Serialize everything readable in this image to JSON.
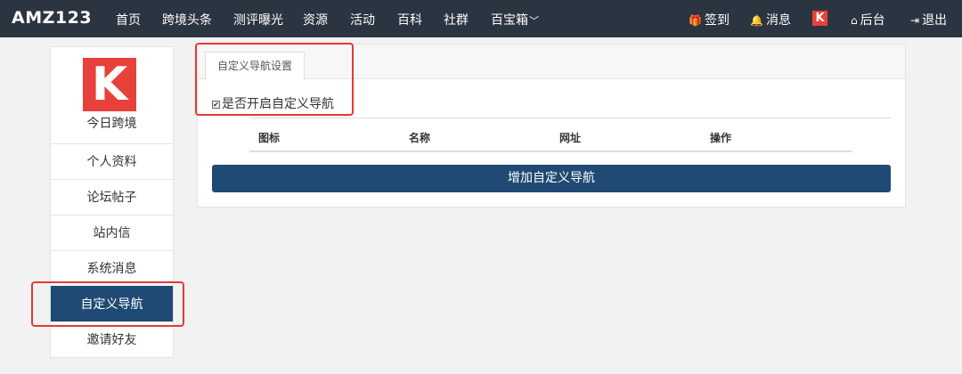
{
  "brand": "AMZ123",
  "nav": {
    "items": [
      "首页",
      "跨境头条",
      "测评曝光",
      "资源",
      "活动",
      "百科",
      "社群",
      "百宝箱"
    ],
    "right": {
      "checkin": "签到",
      "messages": "消息",
      "k_badge": "K",
      "backend": "后台",
      "logout": "退出"
    }
  },
  "sidebar": {
    "logo_letter": "K",
    "site_name": "今日跨境",
    "items": [
      "个人资料",
      "论坛帖子",
      "站内信",
      "系统消息",
      "自定义导航",
      "邀请好友"
    ],
    "active_index": 4
  },
  "panel": {
    "tab_label": "自定义导航设置",
    "checkbox_label": "是否开启自定义导航",
    "checkbox_checked": true,
    "columns": [
      "图标",
      "名称",
      "网址",
      "操作"
    ],
    "add_button": "增加自定义导航"
  },
  "colors": {
    "nav_bg": "#2b3441",
    "accent": "#1f4a73",
    "logo_red": "#e8403b",
    "highlight": "#e53935"
  }
}
